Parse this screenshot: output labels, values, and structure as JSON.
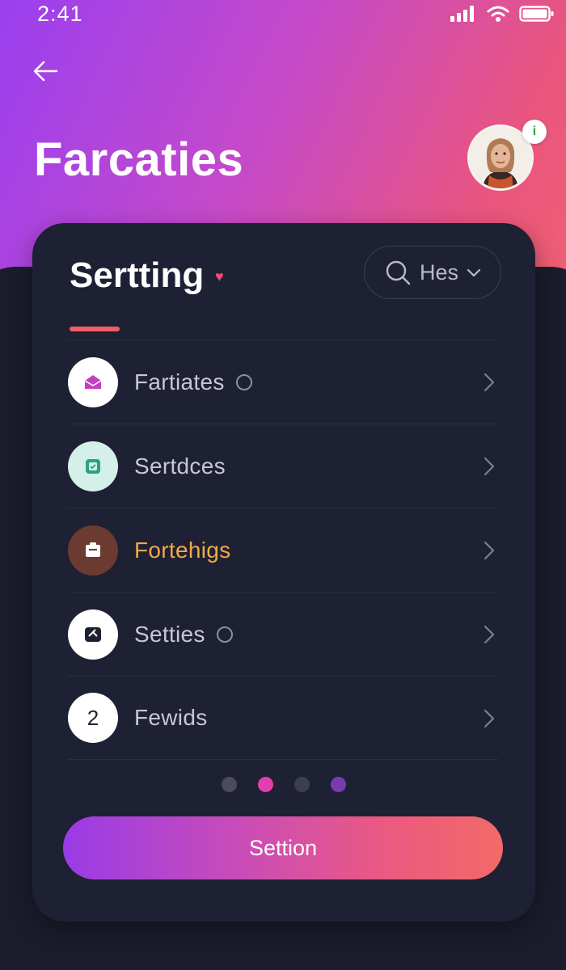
{
  "status_bar": {
    "time": "2:41",
    "icons": [
      "signal-icon",
      "wifi-icon",
      "battery-icon"
    ]
  },
  "header": {
    "title": "Farcaties",
    "avatar_badge": "i"
  },
  "card": {
    "title": "Sertting",
    "help_label": "Hes",
    "items": [
      {
        "label": "Fartiates",
        "icon": "mail-icon",
        "icon_bg": "#ffffff",
        "icon_color": "#c23fc2",
        "label_color": "#c7c8d3",
        "has_dot": true
      },
      {
        "label": "Sertdces",
        "icon": "badge-icon",
        "icon_bg": "#d4f0e8",
        "icon_color": "#2ca37d",
        "label_color": "#c7c8d3",
        "has_dot": false
      },
      {
        "label": "Fortehigs",
        "icon": "clipboard-icon",
        "icon_bg": "#6b3a31",
        "icon_color": "#ffffff",
        "label_color": "#f0a94c",
        "has_dot": false
      },
      {
        "label": "Setties",
        "icon": "gauge-icon",
        "icon_bg": "#ffffff",
        "icon_color": "#1e2033",
        "label_color": "#c7c8d3",
        "has_dot": true
      },
      {
        "label": "Fewids",
        "icon": "number-two-icon",
        "icon_text": "2",
        "icon_bg": "#ffffff",
        "icon_color": "#1e2033",
        "label_color": "#c7c8d3",
        "has_dot": false
      }
    ],
    "pagination": {
      "count": 4,
      "active_index": 1,
      "colors": [
        "#4a4c5c",
        "#e23fae",
        "#3d3f50",
        "#7b3bb0"
      ]
    },
    "cta_label": "Settion"
  },
  "colors": {
    "gradient_start": "#9a3ff0",
    "gradient_end": "#f26070",
    "card_bg": "#1e2033",
    "underline": "#ef5f64"
  }
}
